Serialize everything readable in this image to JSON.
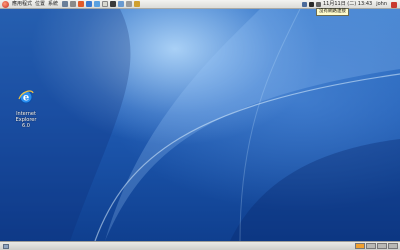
{
  "top_panel": {
    "menus": [
      "應用程式",
      "位置",
      "系統"
    ],
    "clock": "11月11日 (二) 13:43",
    "user": "john",
    "tooltip": "沒有網路連接"
  },
  "desktop": {
    "icons": [
      {
        "label_line1": "Internet Explorer",
        "label_line2": "6.0",
        "icon": "internet-explorer-icon"
      }
    ]
  },
  "bottom_panel": {
    "workspaces": 4,
    "active_workspace": 1
  },
  "colors": {
    "desktop_blue": "#1f5bb3",
    "panel": "#e2e2de",
    "workspace_active": "#f0a030"
  }
}
